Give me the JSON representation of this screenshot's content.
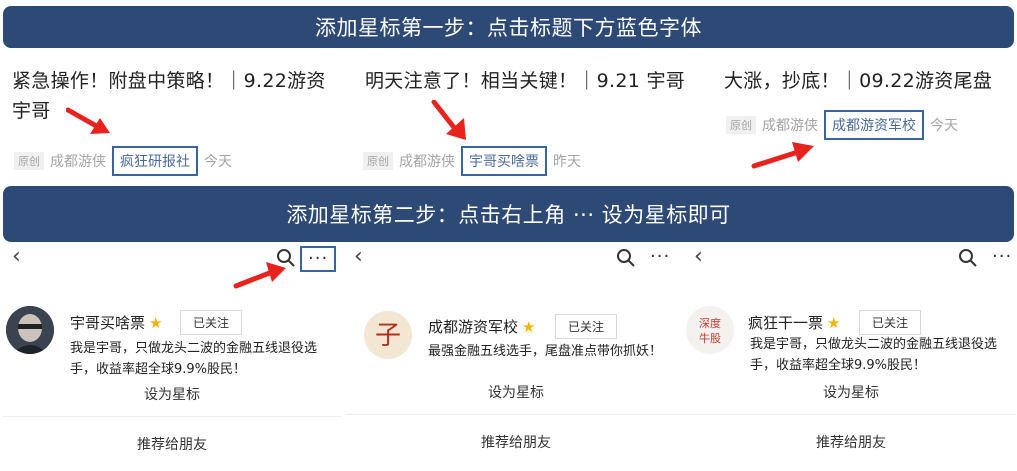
{
  "banners": {
    "step1": "添加星标第一步：点击标题下方蓝色字体",
    "step2": "添加星标第二步：点击右上角 ··· 设为星标即可"
  },
  "articles": [
    {
      "title": "紧急操作！附盘中策略！｜9.22游资宇哥",
      "tag": "原创",
      "author": "成都游侠",
      "account": "疯狂研报社",
      "time": "今天"
    },
    {
      "title": "明天注意了！相当关键！｜9.21 宇哥",
      "tag": "原创",
      "author": "成都游侠",
      "account": "宇哥买啥票",
      "time": "昨天"
    },
    {
      "title": "大涨，抄底！｜09.22游资尾盘",
      "tag": "原创",
      "author": "成都游侠",
      "account": "成都游资军校",
      "time": "今天"
    }
  ],
  "nav": {
    "back": "‹",
    "more": "···"
  },
  "profiles": [
    {
      "name": "宇哥买啥票",
      "follow": "已关注",
      "desc1": "我是宇哥，只做龙头二波的金融五线退役选",
      "desc2": "手，收益率超全球9.9%股民！",
      "set_star": "设为星标",
      "recommend": "推荐给朋友"
    },
    {
      "name": "成都游资军校",
      "follow": "已关注",
      "desc1": "最强金融五线选手，尾盘准点带你抓妖！",
      "desc2": "",
      "set_star": "设为星标",
      "recommend": "推荐给朋友",
      "avatar_char": "子"
    },
    {
      "name": "疯狂干一票",
      "follow": "已关注",
      "desc1": "我是宇哥，只做龙头二波的金融五线退役选",
      "desc2": "手，收益率超全球9.9%股民！",
      "set_star": "设为星标",
      "recommend": "推荐给朋友",
      "avatar_text": "深度牛股"
    }
  ],
  "colors": {
    "banner": "#2c4a75",
    "highlight_border": "#3a64a0",
    "arrow": "#e8231e",
    "star": "#f5b400"
  }
}
